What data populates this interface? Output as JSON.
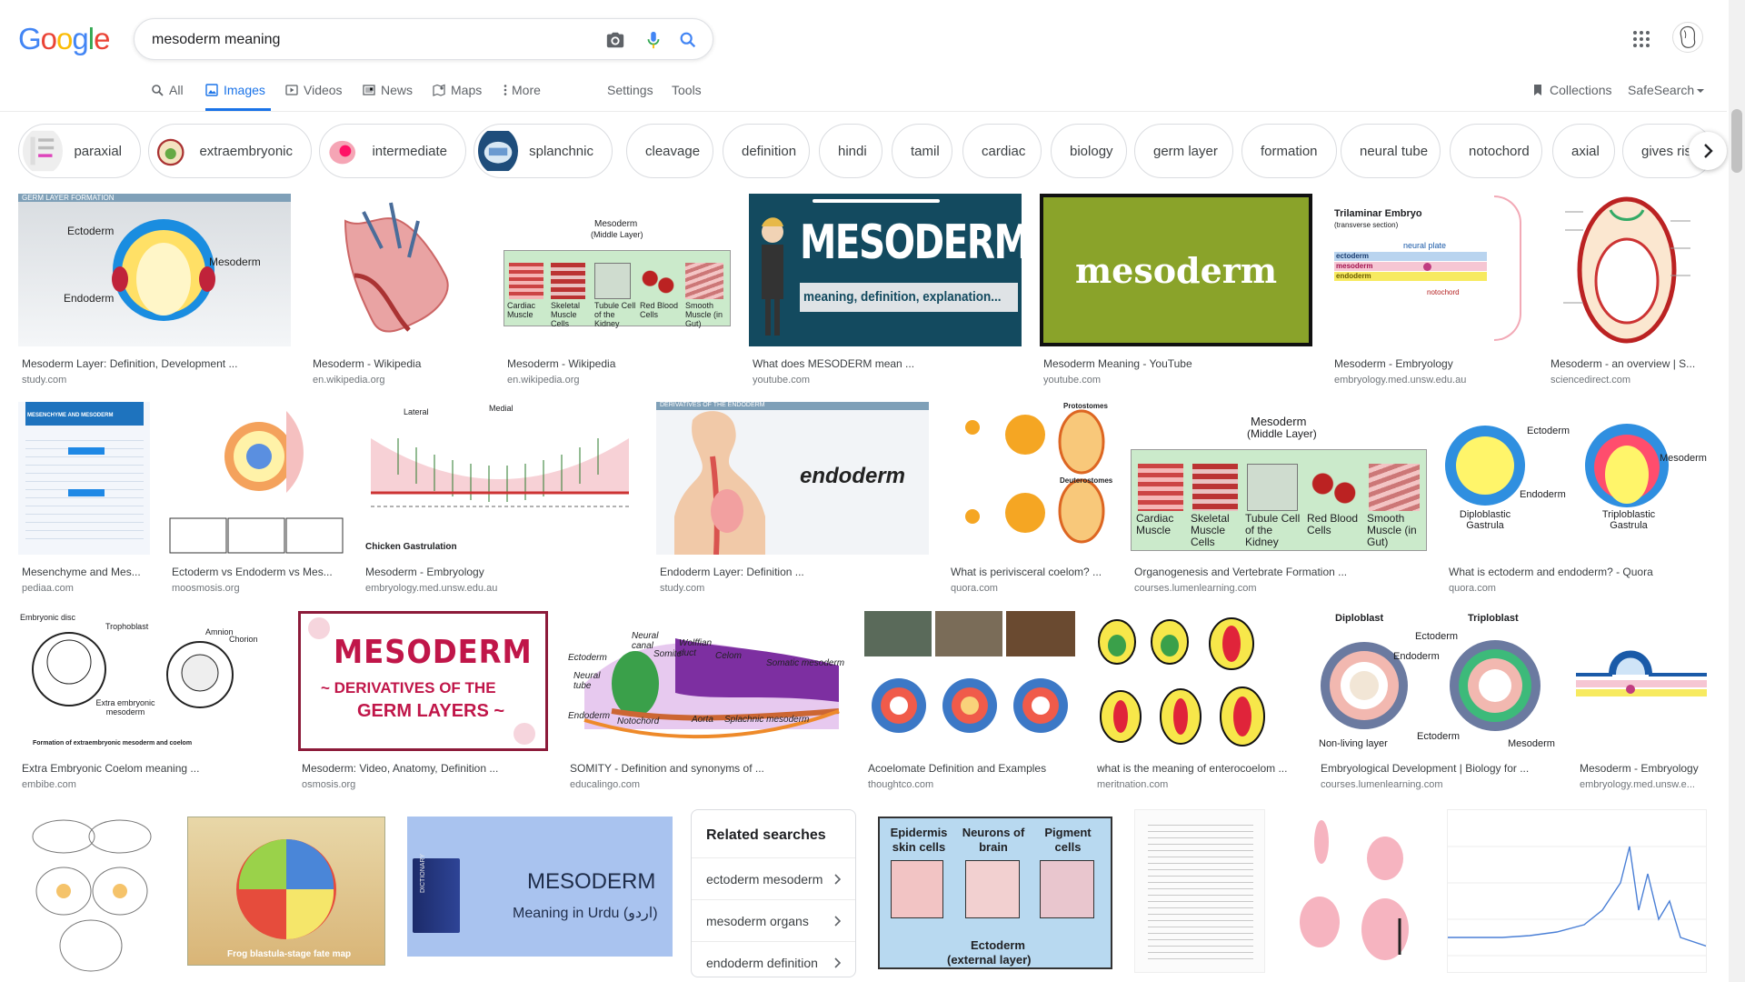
{
  "logo": [
    "G",
    "o",
    "o",
    "g",
    "l",
    "e"
  ],
  "search": {
    "value": "mesoderm meaning"
  },
  "tabs": [
    {
      "label": "All"
    },
    {
      "label": "Images"
    },
    {
      "label": "Videos"
    },
    {
      "label": "News"
    },
    {
      "label": "Maps"
    },
    {
      "label": "More"
    },
    {
      "label": "Settings"
    },
    {
      "label": "Tools"
    },
    {
      "label": "Collections"
    },
    {
      "label": "SafeSearch"
    }
  ],
  "chips": [
    {
      "label": "paraxial"
    },
    {
      "label": "extraembryonic"
    },
    {
      "label": "intermediate"
    },
    {
      "label": "splanchnic"
    },
    {
      "label": "cleavage"
    },
    {
      "label": "definition"
    },
    {
      "label": "hindi"
    },
    {
      "label": "tamil"
    },
    {
      "label": "cardiac"
    },
    {
      "label": "biology"
    },
    {
      "label": "germ layer"
    },
    {
      "label": "formation"
    },
    {
      "label": "neural tube"
    },
    {
      "label": "notochord"
    },
    {
      "label": "axial"
    },
    {
      "label": "gives rise"
    }
  ],
  "results": [
    {
      "caption": "Mesoderm Layer: Definition, Development ...",
      "source": "study.com",
      "img_text": [
        "GERM LAYER FORMATION",
        "Ectoderm",
        "Mesoderm",
        "Endoderm"
      ]
    },
    {
      "caption": "Mesoderm - Wikipedia",
      "source": "en.wikipedia.org"
    },
    {
      "caption": "Mesoderm - Wikipedia",
      "source": "en.wikipedia.org",
      "img_text": [
        "Mesoderm",
        "(Middle Layer)",
        "Cardiac Muscle",
        "Skeletal Muscle Cells",
        "Tubule Cell of the Kidney",
        "Red Blood Cells",
        "Smooth Muscle (in Gut)"
      ]
    },
    {
      "caption": "What does MESODERM mean ...",
      "source": "youtube.com",
      "img_text": [
        "MESODERM",
        "meaning, definition, explanation..."
      ]
    },
    {
      "caption": "Mesoderm Meaning - YouTube",
      "source": "youtube.com",
      "img_text": [
        "mesoderm"
      ]
    },
    {
      "caption": "Mesoderm - Embryology",
      "source": "embryology.med.unsw.edu.au",
      "img_text": [
        "Trilaminar Embryo",
        "(transverse section)",
        "neural plate",
        "ectoderm",
        "mesoderm",
        "endoderm",
        "notochord"
      ]
    },
    {
      "caption": "Mesoderm - an overview | S...",
      "source": "sciencedirect.com"
    },
    {
      "caption": "Mesenchyme and Mes...",
      "source": "pediaa.com",
      "img_text": [
        "MESENCHYME AND MESODERM"
      ]
    },
    {
      "caption": "Ectoderm vs Endoderm vs Mes...",
      "source": "moosmosis.org"
    },
    {
      "caption": "Mesoderm - Embryology",
      "source": "embryology.med.unsw.edu.au",
      "img_text": [
        "Lateral",
        "Medial",
        "Chicken Gastrulation"
      ]
    },
    {
      "caption": "Endoderm Layer: Definition ...",
      "source": "study.com",
      "img_text": [
        "DERIVATIVES OF THE ENDODERM",
        "endoderm"
      ]
    },
    {
      "caption": "What is perivisceral coelom? ...",
      "source": "quora.com",
      "img_text": [
        "Protostomes",
        "Deuterostomes"
      ]
    },
    {
      "caption": "Organogenesis and Vertebrate Formation ...",
      "source": "courses.lumenlearning.com",
      "img_text": [
        "Mesoderm",
        "(Middle Layer)",
        "Cardiac Muscle",
        "Skeletal Muscle Cells",
        "Tubule Cell of the Kidney",
        "Red Blood Cells",
        "Smooth Muscle (in Gut)"
      ]
    },
    {
      "caption": "What is ectoderm and endoderm? - Quora",
      "source": "quora.com",
      "img_text": [
        "Ectoderm",
        "Mesoderm",
        "Endoderm",
        "Diploblastic Gastrula",
        "Triploblastic Gastrula"
      ]
    },
    {
      "caption": "Extra Embryonic Coelom meaning ...",
      "source": "embibe.com",
      "img_text": [
        "Embryonic disc",
        "Trophoblast",
        "Amnion",
        "Chorion",
        "Extra embryonic mesoderm",
        "Formation of extraembryonic mesoderm and coelom"
      ]
    },
    {
      "caption": "Mesoderm: Video, Anatomy, Definition ...",
      "source": "osmosis.org",
      "img_text": [
        "MESODERM",
        "~ DERIVATIVES OF THE",
        "GERM LAYERS ~"
      ]
    },
    {
      "caption": "SOMITY - Definition and synonyms of ...",
      "source": "educalingo.com",
      "img_text": [
        "Neural canal",
        "Wolffian duct",
        "Somite",
        "Celom",
        "Somatic mesoderm",
        "Ectoderm",
        "Neural tube",
        "Endoderm",
        "Notochord",
        "Aorta",
        "Splachnic mesoderm"
      ]
    },
    {
      "caption": "Acoelomate Definition and Examples",
      "source": "thoughtco.com"
    },
    {
      "caption": "what is the meaning of enterocoelom ...",
      "source": "meritnation.com"
    },
    {
      "caption": "Embryological Development | Biology for ...",
      "source": "courses.lumenlearning.com",
      "img_text": [
        "Diploblast",
        "Triploblast",
        "Ectoderm",
        "Endoderm",
        "Non-living layer",
        "Ectoderm",
        "Mesoderm"
      ]
    },
    {
      "caption": "Mesoderm - Embryology",
      "source": "embryology.med.unsw.e..."
    }
  ],
  "bottom_images": [
    {
      "img_text": []
    },
    {
      "img_text": [
        "Frog blastula-stage fate map"
      ]
    },
    {
      "img_text": [
        "MESODERM",
        "Meaning in Urdu (اردو)",
        "DICTIONARY"
      ]
    },
    {
      "img_text": [
        "Epidermis skin cells",
        "Neurons of brain",
        "Pigment cells",
        "Ectoderm",
        "(external layer)"
      ]
    },
    {
      "img_text": []
    },
    {
      "img_text": []
    },
    {
      "img_text": []
    }
  ],
  "related": {
    "title": "Related searches",
    "items": [
      {
        "label": "ectoderm mesoderm"
      },
      {
        "label": "mesoderm organs"
      },
      {
        "label": "endoderm definition"
      }
    ]
  },
  "colors": {
    "accent": "#1a73e8",
    "logo": [
      "#4285f4",
      "#ea4335",
      "#fbbc05",
      "#4285f4",
      "#34a853",
      "#ea4335"
    ]
  }
}
